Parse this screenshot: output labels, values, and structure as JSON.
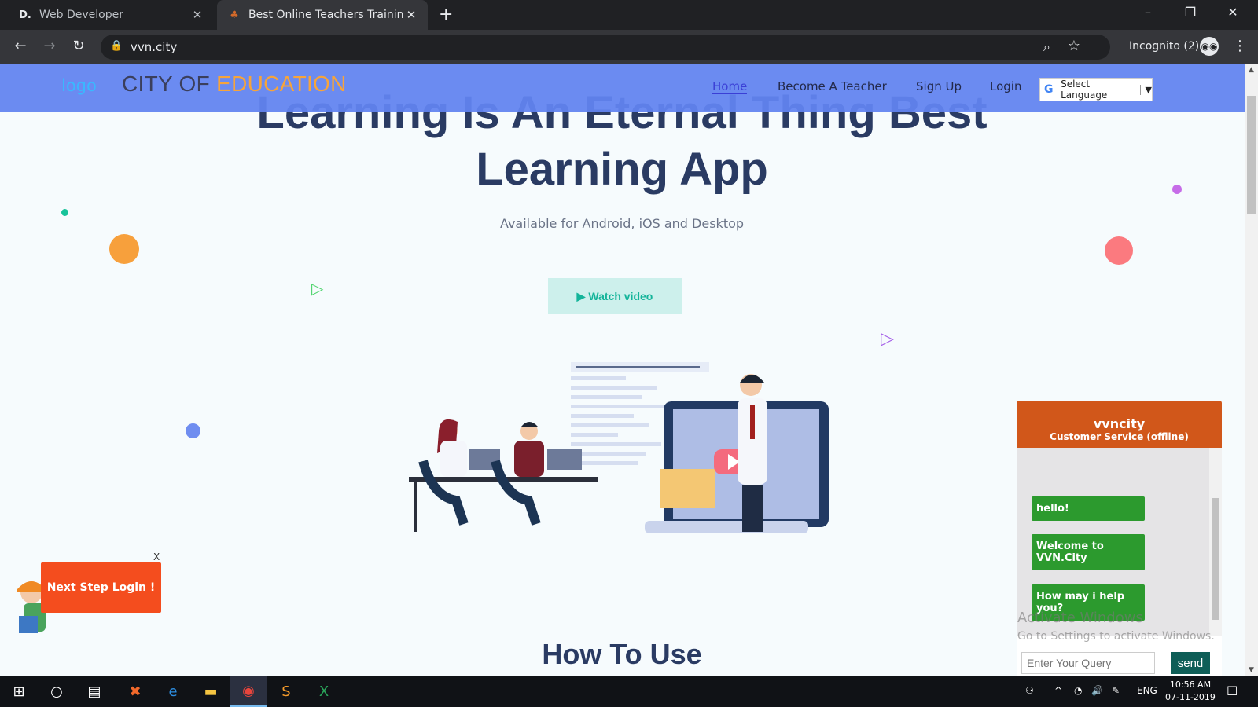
{
  "browser": {
    "tabs": [
      {
        "favicon": "D.",
        "title": "Web Developer"
      },
      {
        "favicon": "tree-icon",
        "title": "Best Online Teachers Training C"
      }
    ],
    "new_tab": "+",
    "url": "vvn.city",
    "incognito": "Incognito (2)"
  },
  "site": {
    "logo_alt": "logo",
    "brand_prefix": "CITY OF",
    "brand_highlight": "EDUCATION",
    "nav": [
      "Home",
      "Become A Teacher",
      "Sign Up",
      "Login"
    ],
    "language_select": "Select Language",
    "hero_title_1": "Learning Is An Eternal Thing Best",
    "hero_title_2": "Learning App",
    "hero_subtitle": "Available for Android, iOS and Desktop",
    "watch_video": "Watch video",
    "section_title": "How To Use",
    "accent_colors": {
      "navbar": "#6284f0",
      "brand_highlight": "#f7a43a",
      "button_text": "#14b49a"
    }
  },
  "chat": {
    "name": "vvncity",
    "status": "Customer Service (offline)",
    "messages": [
      "hello!",
      "Welcome to VVN.City",
      "How may i help you?"
    ],
    "input_placeholder": "Enter Your Query",
    "send": "send"
  },
  "popup": {
    "label": "Next Step Login !",
    "close": "X"
  },
  "watermark": {
    "line1": "Activate Windows",
    "line2": "Go to Settings to activate Windows."
  },
  "taskbar": {
    "language": "ENG",
    "time": "10:56 AM",
    "date": "07-11-2019"
  }
}
